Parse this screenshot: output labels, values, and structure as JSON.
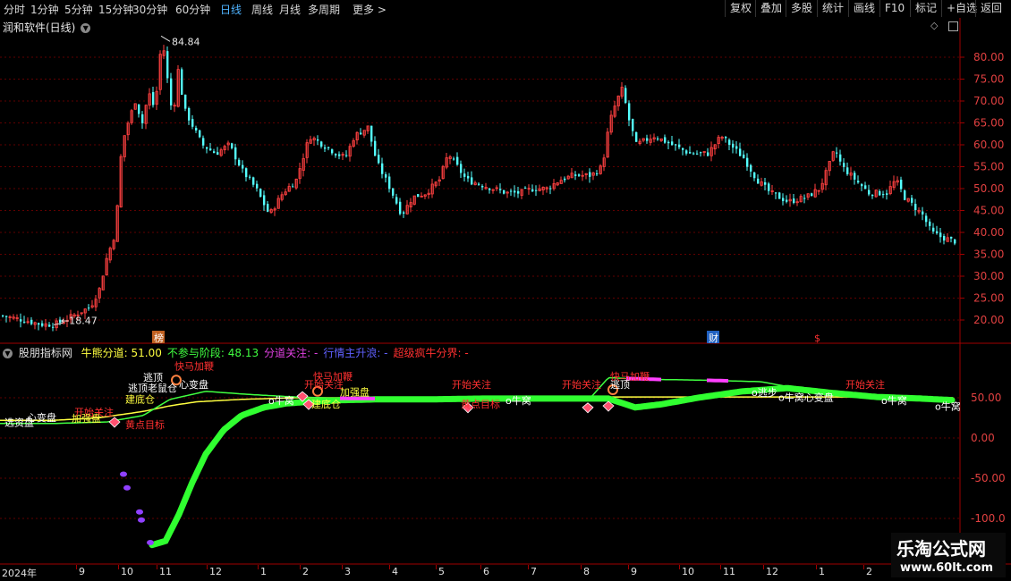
{
  "toolbar": {
    "periods": [
      "分时",
      "1分钟",
      "5分钟",
      "15分钟",
      "30分钟",
      "60分钟",
      "日线",
      "周线",
      "月线",
      "多周期",
      "更多 >"
    ],
    "active_period": "日线",
    "actions": [
      "复权",
      "叠加",
      "多股",
      "统计",
      "画线",
      "F10",
      "标记",
      "+自选",
      "返回"
    ]
  },
  "main_panel": {
    "title": "润和软件(日线)",
    "high_label": "84.84",
    "low_label": "18.47",
    "y_ticks": [
      "80.00",
      "75.00",
      "70.00",
      "65.00",
      "60.00",
      "55.00",
      "50.00",
      "45.00",
      "40.00",
      "35.00",
      "30.00",
      "25.00",
      "20.00"
    ],
    "events": {
      "bang": "榜",
      "cai": "财",
      "dollar": "$"
    },
    "colors": {
      "up": "#ff4040",
      "down": "#54ffff",
      "grid": "#600000"
    },
    "ohlc_data": {
      "type": "candlestick",
      "date_range": [
        "2024-08",
        "2025-03"
      ],
      "close_anchors": [
        [
          0,
          21
        ],
        [
          25,
          20
        ],
        [
          45,
          19
        ],
        [
          60,
          19
        ],
        [
          72,
          20
        ],
        [
          90,
          22
        ],
        [
          100,
          23
        ],
        [
          110,
          27
        ],
        [
          118,
          34
        ],
        [
          128,
          40
        ],
        [
          135,
          60
        ],
        [
          142,
          65
        ],
        [
          150,
          70
        ],
        [
          158,
          65
        ],
        [
          165,
          72
        ],
        [
          172,
          68
        ],
        [
          180,
          84.84
        ],
        [
          186,
          75
        ],
        [
          192,
          66
        ],
        [
          198,
          77
        ],
        [
          205,
          68
        ],
        [
          215,
          64
        ],
        [
          225,
          60
        ],
        [
          240,
          58
        ],
        [
          255,
          60
        ],
        [
          270,
          54
        ],
        [
          285,
          50
        ],
        [
          300,
          44
        ],
        [
          315,
          49
        ],
        [
          330,
          52
        ],
        [
          345,
          62
        ],
        [
          360,
          60
        ],
        [
          375,
          58
        ],
        [
          385,
          57
        ],
        [
          395,
          62
        ],
        [
          410,
          64
        ],
        [
          420,
          56
        ],
        [
          435,
          50
        ],
        [
          448,
          44
        ],
        [
          460,
          48
        ],
        [
          475,
          49
        ],
        [
          490,
          52
        ],
        [
          500,
          58
        ],
        [
          510,
          55
        ],
        [
          520,
          52
        ],
        [
          535,
          51
        ],
        [
          550,
          50
        ],
        [
          565,
          49
        ],
        [
          580,
          49
        ],
        [
          595,
          50
        ],
        [
          610,
          50
        ],
        [
          625,
          52
        ],
        [
          640,
          53
        ],
        [
          660,
          53
        ],
        [
          672,
          55
        ],
        [
          680,
          65
        ],
        [
          688,
          70
        ],
        [
          695,
          73
        ],
        [
          700,
          67
        ],
        [
          710,
          60
        ],
        [
          730,
          62
        ],
        [
          750,
          60
        ],
        [
          770,
          58
        ],
        [
          790,
          58
        ],
        [
          805,
          62
        ],
        [
          815,
          60
        ],
        [
          830,
          57
        ],
        [
          845,
          52
        ],
        [
          860,
          49
        ],
        [
          880,
          47
        ],
        [
          900,
          48
        ],
        [
          915,
          50
        ],
        [
          925,
          55
        ],
        [
          932,
          59
        ],
        [
          940,
          55
        ],
        [
          955,
          52
        ],
        [
          970,
          49
        ],
        [
          990,
          49
        ],
        [
          1000,
          52
        ],
        [
          1010,
          48
        ],
        [
          1020,
          46
        ],
        [
          1030,
          44
        ],
        [
          1040,
          40
        ],
        [
          1050,
          39
        ],
        [
          1065,
          38
        ]
      ]
    }
  },
  "indicator_panel": {
    "name": "股朋指标网",
    "readouts": [
      {
        "label": "牛熊分道:",
        "value": "51.00",
        "color": "#ffff40"
      },
      {
        "label": "不参与阶段:",
        "value": "48.13",
        "color": "#40ff40"
      },
      {
        "label": "分道关注:",
        "value": "-",
        "color": "#e040e0"
      },
      {
        "label": "行情主升浪:",
        "value": "-",
        "color": "#6060ff"
      },
      {
        "label": "超级疯牛分界:",
        "value": "-",
        "color": "#ff3030"
      }
    ],
    "y_ticks": [
      "50.00",
      "0.00",
      "-50.00",
      "-100.0"
    ],
    "series_data": {
      "green_line": [
        [
          0,
          18
        ],
        [
          60,
          18
        ],
        [
          120,
          20
        ],
        [
          160,
          28
        ],
        [
          190,
          48
        ],
        [
          230,
          58
        ],
        [
          280,
          54
        ],
        [
          330,
          51
        ],
        [
          390,
          49
        ],
        [
          450,
          49
        ],
        [
          520,
          50
        ],
        [
          600,
          50
        ],
        [
          660,
          50
        ],
        [
          680,
          75
        ],
        [
          720,
          73
        ],
        [
          780,
          72
        ],
        [
          850,
          70
        ],
        [
          900,
          60
        ],
        [
          960,
          54
        ],
        [
          1010,
          51
        ],
        [
          1065,
          47
        ]
      ],
      "yellow_line": [
        [
          0,
          22
        ],
        [
          60,
          22
        ],
        [
          110,
          25
        ],
        [
          160,
          33
        ],
        [
          190,
          40
        ],
        [
          220,
          45
        ],
        [
          270,
          48
        ],
        [
          330,
          50
        ],
        [
          390,
          50
        ],
        [
          460,
          50
        ],
        [
          540,
          50
        ],
        [
          620,
          50
        ],
        [
          680,
          51
        ],
        [
          740,
          51
        ],
        [
          800,
          51
        ],
        [
          860,
          51
        ],
        [
          960,
          51
        ],
        [
          1065,
          50
        ]
      ],
      "thick_green": [
        [
          170,
          -133
        ],
        [
          185,
          -128
        ],
        [
          200,
          -95
        ],
        [
          215,
          -55
        ],
        [
          230,
          -20
        ],
        [
          250,
          10
        ],
        [
          270,
          28
        ],
        [
          295,
          38
        ],
        [
          320,
          43
        ],
        [
          345,
          45
        ],
        [
          380,
          47
        ],
        [
          420,
          48
        ],
        [
          480,
          48
        ],
        [
          540,
          49
        ],
        [
          620,
          49
        ],
        [
          680,
          49
        ],
        [
          710,
          38
        ],
        [
          740,
          42
        ],
        [
          780,
          50
        ],
        [
          830,
          58
        ],
        [
          880,
          62
        ],
        [
          930,
          56
        ],
        [
          980,
          51
        ],
        [
          1030,
          49
        ],
        [
          1065,
          47
        ]
      ],
      "purple_points": [
        [
          138,
          -45
        ],
        [
          142,
          -62
        ],
        [
          156,
          -92
        ],
        [
          158,
          -102
        ],
        [
          168,
          -130
        ]
      ],
      "labels": [
        {
          "x": 5,
          "y": 15,
          "text": "选资盘"
        },
        {
          "x": 30,
          "y": 21,
          "text": "心变盘",
          "color": "#ffffff"
        },
        {
          "x": 83,
          "y": 28,
          "text": "开始关注",
          "color": "#ff3030"
        },
        {
          "x": 80,
          "y": 20,
          "text": "加强盘",
          "color": "#ffff40"
        },
        {
          "x": 140,
          "y": 12,
          "text": "黄点目标",
          "color": "#ff3030"
        },
        {
          "x": 140,
          "y": 44,
          "text": "建底仓",
          "color": "#ffff40"
        },
        {
          "x": 143,
          "y": 58,
          "text": "逃顶老鼠仓",
          "color": "#ffffff"
        },
        {
          "x": 160,
          "y": 71,
          "text": "逃顶",
          "color": "#ffffff"
        },
        {
          "x": 195,
          "y": 85,
          "text": "快马加鞭",
          "color": "#ff3030"
        },
        {
          "x": 200,
          "y": 62,
          "text": "心变盘",
          "color": "#ffffff"
        },
        {
          "x": 300,
          "y": 42,
          "text": "o牛窝",
          "color": "#ffffff"
        },
        {
          "x": 340,
          "y": 62,
          "text": "开始关注",
          "color": "#ff3030"
        },
        {
          "x": 350,
          "y": 72,
          "text": "快马加鞭",
          "color": "#ff3030"
        },
        {
          "x": 348,
          "y": 38,
          "text": "建底仓",
          "color": "#ffff40"
        },
        {
          "x": 380,
          "y": 53,
          "text": "加强盘",
          "color": "#ffff40"
        },
        {
          "x": 505,
          "y": 62,
          "text": "开始关注",
          "color": "#ff3030"
        },
        {
          "x": 515,
          "y": 38,
          "text": "黄点目标",
          "color": "#ff3030"
        },
        {
          "x": 565,
          "y": 42,
          "text": "o牛窝",
          "color": "#ffffff"
        },
        {
          "x": 628,
          "y": 62,
          "text": "开始关注",
          "color": "#ff3030"
        },
        {
          "x": 682,
          "y": 72,
          "text": "快马加鞭",
          "color": "#ff3030"
        },
        {
          "x": 682,
          "y": 62,
          "text": "逃顶",
          "color": "#ffffff"
        },
        {
          "x": 840,
          "y": 52,
          "text": "o逃步",
          "color": "#ffffff"
        },
        {
          "x": 870,
          "y": 46,
          "text": "o牛窝心变盘",
          "color": "#ffffff"
        },
        {
          "x": 945,
          "y": 62,
          "text": "开始关注",
          "color": "#ff3030"
        },
        {
          "x": 985,
          "y": 42,
          "text": "o牛窝",
          "color": "#ffffff"
        },
        {
          "x": 1045,
          "y": 35,
          "text": "o牛窝",
          "color": "#ffffff"
        }
      ]
    }
  },
  "date_axis": {
    "labels": [
      {
        "x": 2,
        "text": "2024年"
      },
      {
        "x": 88,
        "text": "9"
      },
      {
        "x": 135,
        "text": "10"
      },
      {
        "x": 178,
        "text": "11"
      },
      {
        "x": 234,
        "text": "12"
      },
      {
        "x": 291,
        "text": "1"
      },
      {
        "x": 338,
        "text": "2"
      },
      {
        "x": 385,
        "text": "3"
      },
      {
        "x": 438,
        "text": "4"
      },
      {
        "x": 490,
        "text": "5"
      },
      {
        "x": 540,
        "text": "6"
      },
      {
        "x": 593,
        "text": "7"
      },
      {
        "x": 652,
        "text": "8"
      },
      {
        "x": 705,
        "text": "9"
      },
      {
        "x": 762,
        "text": "10"
      },
      {
        "x": 808,
        "text": "11"
      },
      {
        "x": 856,
        "text": "12"
      },
      {
        "x": 915,
        "text": "1"
      },
      {
        "x": 968,
        "text": "2"
      }
    ]
  },
  "watermark": {
    "line1": "乐淘公式网",
    "line2": "www.60lt.com"
  }
}
